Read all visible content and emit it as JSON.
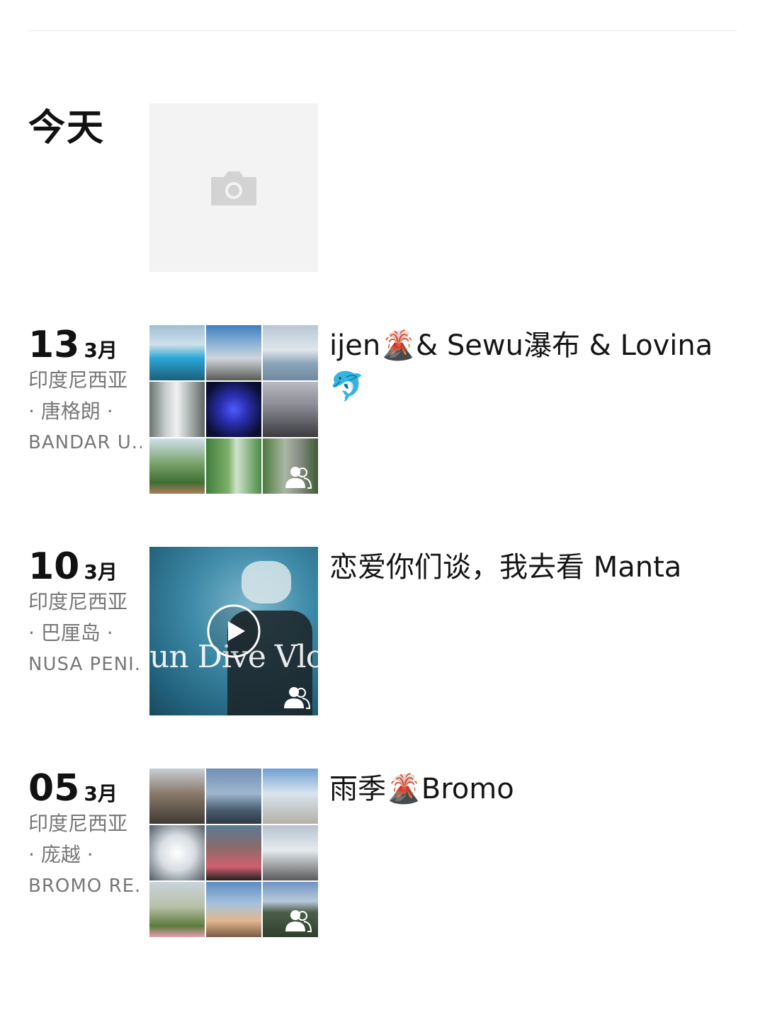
{
  "today": {
    "label": "今天"
  },
  "entries": [
    {
      "day": "13",
      "month": "3月",
      "location": [
        "印度尼西亚",
        "· 唐格朗 ·",
        "BANDAR U..."
      ],
      "caption": "ijen🌋& Sewu瀑布 & Lovina 🐬"
    },
    {
      "day": "10",
      "month": "3月",
      "location": [
        "印度尼西亚",
        "· 巴厘岛 ·",
        "NUSA PENI..."
      ],
      "caption": "恋爱你们谈，我去看 Manta",
      "video_overlay_text": "un Dive Vlo"
    },
    {
      "day": "05",
      "month": "3月",
      "location": [
        "印度尼西亚",
        "· 庞越 ·",
        "BROMO RE..."
      ],
      "caption": "雨季🌋Bromo"
    }
  ],
  "colors": {
    "placeholder_bg": "#f3f3f3",
    "secondary_text": "#777777",
    "divider": "#e6e6e6"
  },
  "icons": [
    "camera-icon",
    "play-icon",
    "people-icon"
  ]
}
